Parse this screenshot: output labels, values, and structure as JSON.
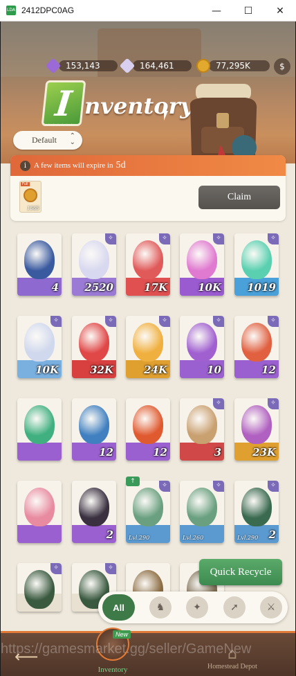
{
  "window": {
    "title": "2412DPC0AG",
    "minimize": "—",
    "maximize": "☐",
    "close": "✕"
  },
  "currency": [
    {
      "name": "purple-crystal-icon",
      "value": "153,143",
      "color": "#9b6ad6"
    },
    {
      "name": "diamond-icon",
      "value": "164,461",
      "color": "#d8d0ee"
    },
    {
      "name": "gold-coin-icon",
      "value": "77,295K",
      "color": "#e2a92f"
    }
  ],
  "header": {
    "title_letter": "I",
    "title_rest": "nventory"
  },
  "sort": {
    "label": "Default"
  },
  "expire": {
    "text": "A few items will expire in",
    "days": "5d",
    "item_tag": "Full",
    "item_count": "1565",
    "claim_label": "Claim"
  },
  "items": [
    {
      "name": "item-tea-cup",
      "count": "4",
      "art": "#3a5aa0",
      "base": "#8e6ad0",
      "badge": false
    },
    {
      "name": "item-white-crystal",
      "count": "2520",
      "art": "#d8d8f0",
      "base": "#9a7ad4",
      "badge": true
    },
    {
      "name": "item-red-crystal",
      "count": "17K",
      "art": "#e05a5a",
      "base": "#e05050",
      "badge": true
    },
    {
      "name": "item-pink-crystal",
      "count": "10K",
      "art": "#e07ad0",
      "base": "#9a5ad0",
      "badge": true
    },
    {
      "name": "item-green-crystal",
      "count": "1019",
      "art": "#5ad0b0",
      "base": "#4aa0d8",
      "badge": true
    },
    {
      "name": "item-white-potion",
      "count": "10K",
      "art": "#d0d8ee",
      "base": "#7ab0e0",
      "badge": true
    },
    {
      "name": "item-red-potion",
      "count": "32K",
      "art": "#e04848",
      "base": "#d84040",
      "badge": true
    },
    {
      "name": "item-yellow-potion",
      "count": "24K",
      "art": "#f0b040",
      "base": "#e0a030",
      "badge": true
    },
    {
      "name": "item-purple-emblem",
      "count": "10",
      "art": "#a060d0",
      "base": "#9a60d0",
      "badge": true
    },
    {
      "name": "item-fire-emblem",
      "count": "12",
      "art": "#e06040",
      "base": "#9a60d0",
      "badge": true
    },
    {
      "name": "item-green-emblem",
      "count": "",
      "art": "#40b080",
      "base": "#9a60d0",
      "badge": false
    },
    {
      "name": "item-blue-emblem",
      "count": "12",
      "art": "#4080c0",
      "base": "#9a60d0",
      "badge": false
    },
    {
      "name": "item-flame-emblem",
      "count": "12",
      "art": "#e05a30",
      "base": "#9a60d0",
      "badge": false
    },
    {
      "name": "item-scroll",
      "count": "3",
      "art": "#c9a070",
      "base": "#d04848",
      "badge": true
    },
    {
      "name": "item-purple-potion",
      "count": "23K",
      "art": "#b060c0",
      "base": "#e0a030",
      "badge": true
    },
    {
      "name": "item-hero-portrait-pink",
      "count": "",
      "art": "#e88aa0",
      "base": "#9a60d0",
      "badge": false
    },
    {
      "name": "item-hero-portrait-dark",
      "count": "2",
      "art": "#3a3040",
      "base": "#9a60d0",
      "badge": false
    },
    {
      "name": "item-boots-1",
      "count": "",
      "level": "Lvl.290",
      "art": "#6aa080",
      "base": "#5a9ad0",
      "badge": true,
      "upgrade": true
    },
    {
      "name": "item-boots-2",
      "count": "",
      "level": "Lvl.260",
      "art": "#6aa080",
      "base": "#5a9ad0",
      "badge": true
    },
    {
      "name": "item-cloak",
      "count": "2",
      "level": "Lvl.290",
      "art": "#3a6a50",
      "base": "#5a9ad0",
      "badge": true
    },
    {
      "name": "item-cloak-2",
      "count": "",
      "art": "#3a5a40",
      "base": "#e8e0d0",
      "badge": true
    },
    {
      "name": "item-cloak-3",
      "count": "",
      "art": "#3a5a40",
      "base": "#e8e0d0",
      "badge": true
    },
    {
      "name": "item-pouch",
      "count": "",
      "art": "#8a6a40",
      "base": "#e8e0d0",
      "badge": false
    },
    {
      "name": "item-armor",
      "count": "",
      "art": "#7a6a50",
      "base": "#e8e0d0",
      "badge": false
    }
  ],
  "quick_recycle": {
    "label": "Quick Recycle"
  },
  "filters": {
    "all_label": "All",
    "icons": [
      "horse-icon",
      "star-compass-icon",
      "compass-icon",
      "sword-icon"
    ]
  },
  "nav": {
    "inventory_label": "Inventory",
    "new_badge": "New",
    "depot_label": "Homestead Depot",
    "back_icon": "back-arrow-icon"
  },
  "watermark": "https://gamesmarket.gg/seller/GameNew"
}
